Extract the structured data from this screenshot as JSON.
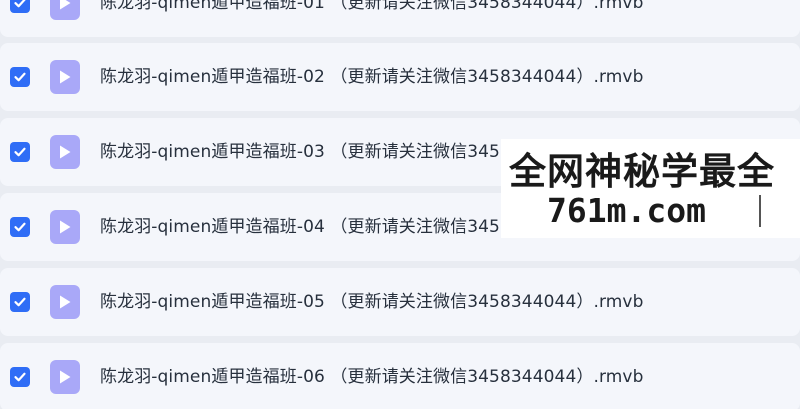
{
  "files": [
    {
      "name": "陈龙羽-qimen遁甲造福班-01 （更新请关注微信3458344044）.rmvb",
      "checked": true,
      "icon": "video-play-icon"
    },
    {
      "name": "陈龙羽-qimen遁甲造福班-02 （更新请关注微信3458344044）.rmvb",
      "checked": true,
      "icon": "video-play-icon"
    },
    {
      "name": "陈龙羽-qimen遁甲造福班-03 （更新请关注微信3458344044）.rmvb",
      "checked": true,
      "icon": "video-play-icon"
    },
    {
      "name": "陈龙羽-qimen遁甲造福班-04 （更新请关注微信3458344044）.rmvb",
      "checked": true,
      "icon": "video-play-icon"
    },
    {
      "name": "陈龙羽-qimen遁甲造福班-05 （更新请关注微信3458344044）.rmvb",
      "checked": true,
      "icon": "video-play-icon"
    },
    {
      "name": "陈龙羽-qimen遁甲造福班-06 （更新请关注微信3458344044）.rmvb",
      "checked": true,
      "icon": "video-play-icon"
    }
  ],
  "watermark": {
    "line1": "全网神秘学最全",
    "line2": "761m.com"
  },
  "colors": {
    "checkbox": "#2f6df6",
    "file_icon": "#a9a8f8",
    "row_bg": "#f4f6fb",
    "page_bg": "#e9ecf2"
  }
}
